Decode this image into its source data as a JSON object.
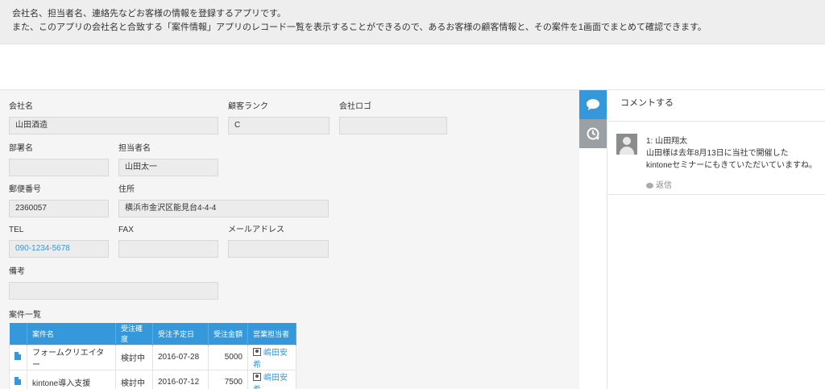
{
  "description": {
    "line1": "会社名、担当者名、連絡先などお客様の情報を登録するアプリです。",
    "line2": "また、このアプリの会社名と合致する「案件情報」アプリのレコード一覧を表示することができるので、あるお客様の顧客情報と、その案件を1画面でまとめて確認できます。"
  },
  "fields": {
    "company": {
      "label": "会社名",
      "value": "山田酒造"
    },
    "rank": {
      "label": "顧客ランク",
      "value": "C"
    },
    "logo": {
      "label": "会社ロゴ",
      "value": ""
    },
    "department": {
      "label": "部署名",
      "value": ""
    },
    "person": {
      "label": "担当者名",
      "value": "山田太一"
    },
    "zip": {
      "label": "郵便番号",
      "value": "2360057"
    },
    "address": {
      "label": "住所",
      "value": "横浜市金沢区能見台4-4-4"
    },
    "tel": {
      "label": "TEL",
      "value": "090-1234-5678"
    },
    "fax": {
      "label": "FAX",
      "value": ""
    },
    "email": {
      "label": "メールアドレス",
      "value": ""
    },
    "notes": {
      "label": "備考",
      "value": ""
    }
  },
  "cases": {
    "label": "案件一覧",
    "headers": [
      "案件名",
      "受注確度",
      "受注予定日",
      "受注金額",
      "営業担当者"
    ],
    "rows": [
      {
        "name": "フォームクリエイター",
        "probability": "検討中",
        "date": "2016-07-28",
        "amount": "5000",
        "rep": "嶋田安希"
      },
      {
        "name": "kintone導入支援",
        "probability": "検討中",
        "date": "2016-07-12",
        "amount": "7500",
        "rep": "嶋田安希"
      }
    ]
  },
  "sidebar": {
    "comment_tab_icon": "comment-icon",
    "history_tab_icon": "history-icon"
  },
  "comments": {
    "post_link": "コメントする",
    "items": [
      {
        "author": "1: 山田翔太",
        "line1": "山田様は去年8月13日に当社で開催した",
        "line2": "kintoneセミナーにもきていただいていますね。",
        "reply": "返信"
      }
    ]
  },
  "colors": {
    "accent": "#3498db",
    "field_bg": "#ececec",
    "form_bg": "#f5f5f5"
  }
}
